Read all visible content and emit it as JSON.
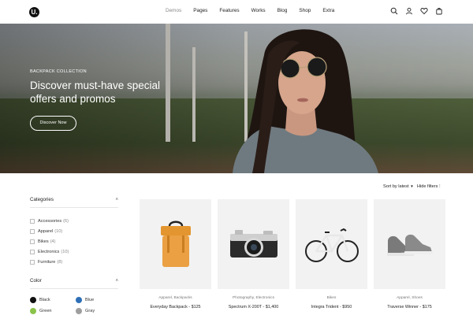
{
  "header": {
    "logo_text": "U.",
    "nav": [
      {
        "label": "Demos",
        "state": "muted"
      },
      {
        "label": "Pages",
        "state": "normal"
      },
      {
        "label": "Features",
        "state": "normal"
      },
      {
        "label": "Works",
        "state": "normal"
      },
      {
        "label": "Blog",
        "state": "normal"
      },
      {
        "label": "Shop",
        "state": "normal"
      },
      {
        "label": "Extra",
        "state": "normal"
      }
    ],
    "icons": [
      "search-icon",
      "user-icon",
      "heart-icon",
      "bag-icon"
    ]
  },
  "hero": {
    "subtitle": "BACKPACK COLLECTION",
    "title": "Discover must-have special offers and promos",
    "button_label": "Discover Now"
  },
  "toolbar": {
    "sort_label": "Sort by latest",
    "hide_filters_label": "Hide filters"
  },
  "sidebar": {
    "categories_title": "Categories",
    "categories": [
      {
        "label": "Accessories",
        "count": "(6)"
      },
      {
        "label": "Apparel",
        "count": "(10)"
      },
      {
        "label": "Bikes",
        "count": "(4)"
      },
      {
        "label": "Electronics",
        "count": "(10)"
      },
      {
        "label": "Furniture",
        "count": "(8)"
      }
    ],
    "color_title": "Color",
    "colors": [
      {
        "label": "Black",
        "hex": "#111111"
      },
      {
        "label": "Blue",
        "hex": "#2e6fb6"
      },
      {
        "label": "Green",
        "hex": "#8bc34a"
      },
      {
        "label": "Gray",
        "hex": "#9e9e9e"
      }
    ]
  },
  "products": [
    {
      "category": "Apparel, Backpacks",
      "name": "Everyday Backpack - $125",
      "icon": "backpack-icon"
    },
    {
      "category": "Photography, Electronics",
      "name": "Spectrum X-200T - $1,400",
      "icon": "camera-icon"
    },
    {
      "category": "Bikes",
      "name": "Integra Trident - $950",
      "icon": "bike-icon"
    },
    {
      "category": "Apparel, Shoes",
      "name": "Traverse Winner - $175",
      "icon": "sneaker-icon"
    }
  ]
}
